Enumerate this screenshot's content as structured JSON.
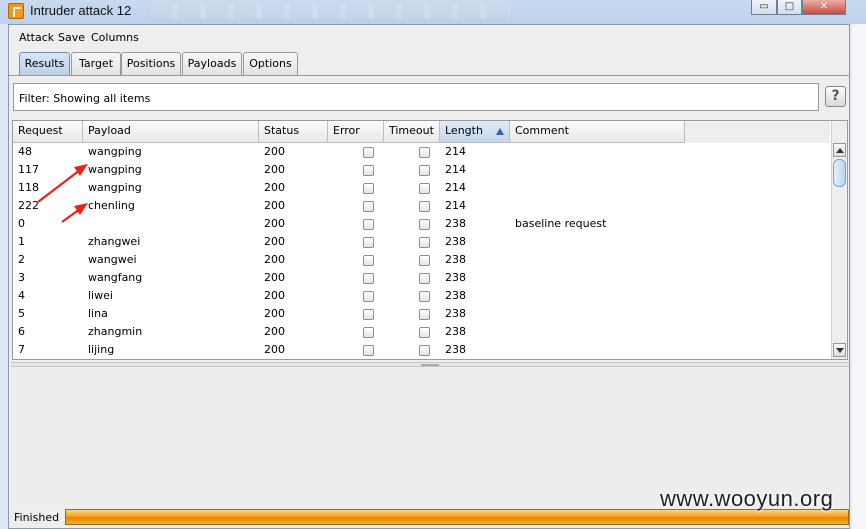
{
  "window": {
    "title": "Intruder attack 12",
    "minimize_glyph": "▭",
    "restore_glyph": "□",
    "close_glyph": "✕"
  },
  "menu": [
    "Attack",
    "Save",
    "Columns"
  ],
  "tabs": [
    "Results",
    "Target",
    "Positions",
    "Payloads",
    "Options"
  ],
  "active_tab": "Results",
  "filter": {
    "text": "Filter:  Showing all items",
    "help_label": "?"
  },
  "table": {
    "columns": [
      "Request",
      "Payload",
      "Status",
      "Error",
      "Timeout",
      "Length",
      "Comment"
    ],
    "sorted_column": "Length",
    "rows": [
      {
        "request": "48",
        "payload": "wangping",
        "status": "200",
        "error": false,
        "timeout": false,
        "length": "214",
        "comment": ""
      },
      {
        "request": "117",
        "payload": "wangping",
        "status": "200",
        "error": false,
        "timeout": false,
        "length": "214",
        "comment": ""
      },
      {
        "request": "118",
        "payload": "wangping",
        "status": "200",
        "error": false,
        "timeout": false,
        "length": "214",
        "comment": ""
      },
      {
        "request": "222",
        "payload": "chenling",
        "status": "200",
        "error": false,
        "timeout": false,
        "length": "214",
        "comment": ""
      },
      {
        "request": "0",
        "payload": "",
        "status": "200",
        "error": false,
        "timeout": false,
        "length": "238",
        "comment": "baseline request"
      },
      {
        "request": "1",
        "payload": "zhangwei",
        "status": "200",
        "error": false,
        "timeout": false,
        "length": "238",
        "comment": ""
      },
      {
        "request": "2",
        "payload": "wangwei",
        "status": "200",
        "error": false,
        "timeout": false,
        "length": "238",
        "comment": ""
      },
      {
        "request": "3",
        "payload": "wangfang",
        "status": "200",
        "error": false,
        "timeout": false,
        "length": "238",
        "comment": ""
      },
      {
        "request": "4",
        "payload": "liwei",
        "status": "200",
        "error": false,
        "timeout": false,
        "length": "238",
        "comment": ""
      },
      {
        "request": "5",
        "payload": "lina",
        "status": "200",
        "error": false,
        "timeout": false,
        "length": "238",
        "comment": ""
      },
      {
        "request": "6",
        "payload": "zhangmin",
        "status": "200",
        "error": false,
        "timeout": false,
        "length": "238",
        "comment": ""
      },
      {
        "request": "7",
        "payload": "lijing",
        "status": "200",
        "error": false,
        "timeout": false,
        "length": "238",
        "comment": ""
      }
    ]
  },
  "status": {
    "label": "Finished",
    "progress": 1.0
  },
  "watermark": "www.wooyun.org",
  "colors": {
    "progress": "#f7a21d",
    "annotation_arrow": "#e8231a",
    "sort_indicator": "#2d64b6",
    "active_tab": "#b9cfe6"
  },
  "icons": [
    "burp-app-icon",
    "minimize-icon",
    "restore-icon",
    "close-icon",
    "sort-ascending-icon",
    "help-icon",
    "scroll-up-icon",
    "scroll-down-icon",
    "red-arrow-annotation"
  ]
}
